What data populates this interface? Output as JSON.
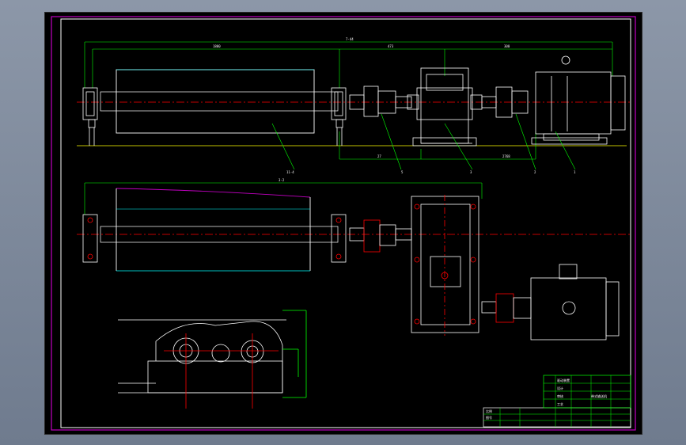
{
  "drawing": {
    "dimensions": {
      "overall_top": "7-44",
      "roller_span": "1800",
      "coupling_span": "473",
      "motor_span": "300",
      "lower_a": "27",
      "lower_b": "2768",
      "plan_span": "3-2"
    },
    "leaders": [
      "11-4",
      "5",
      "3",
      "2",
      "1"
    ],
    "title_block": {
      "drawing_title": "带式输送机",
      "rows": [
        "驱动装置",
        "设计",
        "审核",
        "工艺",
        "比例",
        "图号"
      ]
    }
  },
  "colors": {
    "background": "#000000",
    "border": "#c000c0",
    "geometry": "#ffffff",
    "centerline": "#ff0000",
    "dimension": "#00ff00",
    "cyan": "#00ffff",
    "yellow": "#ffff00"
  }
}
